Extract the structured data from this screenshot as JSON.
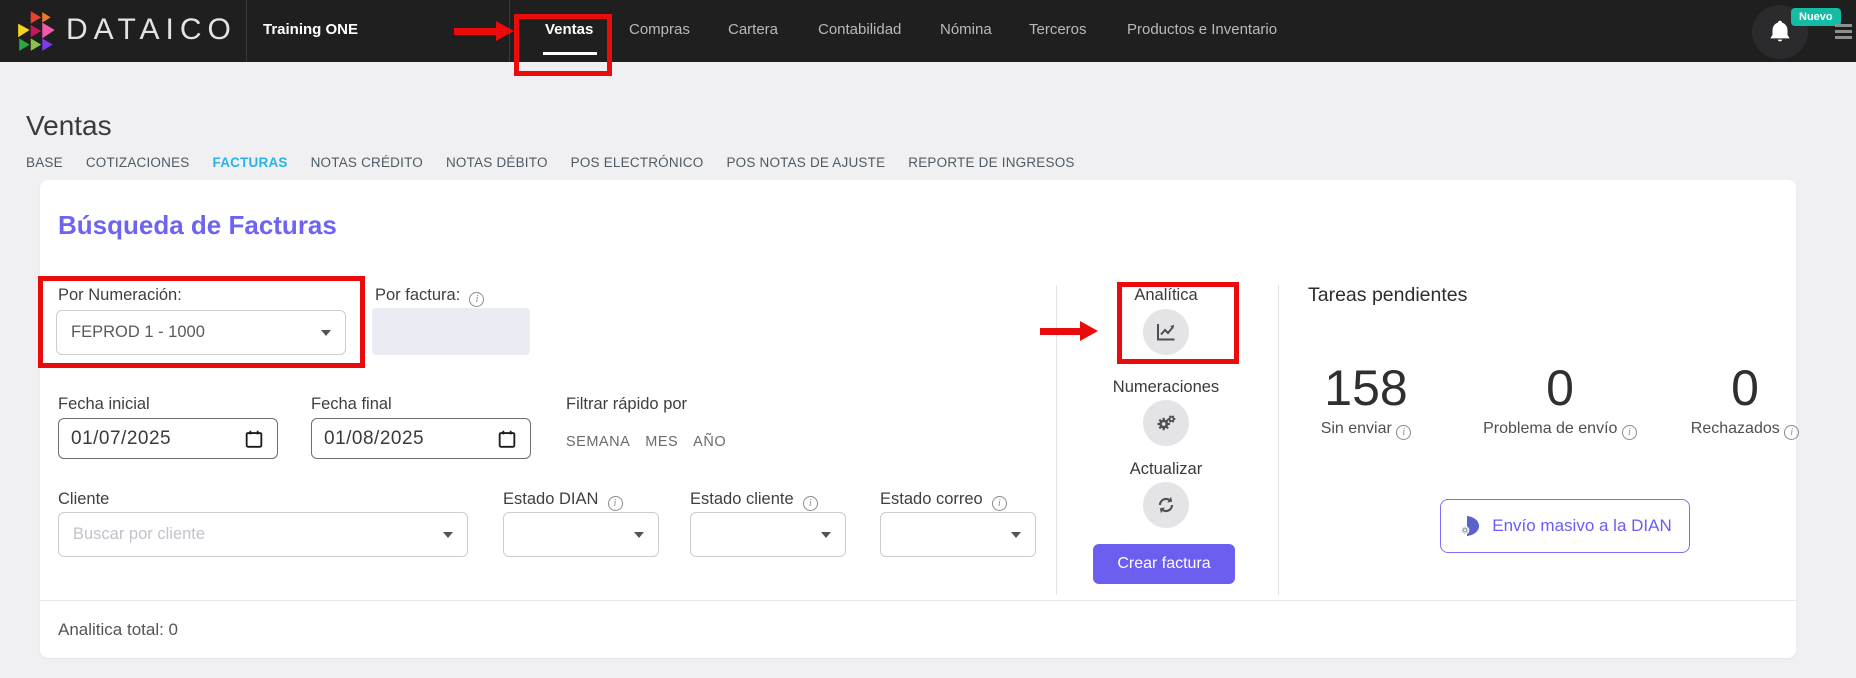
{
  "navbar": {
    "brand": "DATAICO",
    "company": "Training ONE",
    "new_badge": "Nuevo",
    "items": [
      {
        "label": "Ventas",
        "active": true
      },
      {
        "label": "Compras",
        "active": false
      },
      {
        "label": "Cartera",
        "active": false
      },
      {
        "label": "Contabilidad",
        "active": false
      },
      {
        "label": "Nómina",
        "active": false
      },
      {
        "label": "Terceros",
        "active": false
      },
      {
        "label": "Productos e Inventario",
        "active": false
      }
    ]
  },
  "page": {
    "title": "Ventas",
    "tabs": [
      {
        "label": "BASE",
        "active": false
      },
      {
        "label": "COTIZACIONES",
        "active": false
      },
      {
        "label": "FACTURAS",
        "active": true
      },
      {
        "label": "NOTAS CRÉDITO",
        "active": false
      },
      {
        "label": "NOTAS DÉBITO",
        "active": false
      },
      {
        "label": "POS ELECTRÓNICO",
        "active": false
      },
      {
        "label": "POS NOTAS DE AJUSTE",
        "active": false
      },
      {
        "label": "REPORTE DE INGRESOS",
        "active": false
      }
    ]
  },
  "card": {
    "title": "Búsqueda de Facturas",
    "filters": {
      "numeracion": {
        "label": "Por Numeración:",
        "value": "FEPROD 1 - 1000"
      },
      "factura": {
        "label": "Por factura:",
        "value": ""
      },
      "fecha_inicial": {
        "label": "Fecha inicial",
        "value": "01/07/2025"
      },
      "fecha_final": {
        "label": "Fecha final",
        "value": "01/08/2025"
      },
      "quick": {
        "label": "Filtrar rápido por",
        "options": [
          "SEMANA",
          "MES",
          "AÑO"
        ]
      },
      "cliente": {
        "label": "Cliente",
        "placeholder": "Buscar por cliente"
      },
      "estado_dian": {
        "label": "Estado DIAN",
        "value": ""
      },
      "estado_cliente": {
        "label": "Estado cliente",
        "value": ""
      },
      "estado_correo": {
        "label": "Estado correo",
        "value": ""
      }
    },
    "actions": {
      "analitica": "Analítica",
      "numeraciones": "Numeraciones",
      "actualizar": "Actualizar",
      "crear_factura": "Crear factura"
    },
    "tareas": {
      "title": "Tareas pendientes",
      "stats": [
        {
          "value": "158",
          "label": "Sin enviar"
        },
        {
          "value": "0",
          "label": "Problema de envío"
        },
        {
          "value": "0",
          "label": "Rechazados"
        }
      ],
      "envio_masivo": "Envío masivo a la DIAN"
    },
    "footer": "Analitica total: 0"
  },
  "colors": {
    "accent_purple": "#6c5ff0",
    "tab_active_blue": "#29b2e8",
    "badge_teal": "#15bca4",
    "annotation_red": "#ea0c0c",
    "navbar_bg": "#1f1f20"
  }
}
